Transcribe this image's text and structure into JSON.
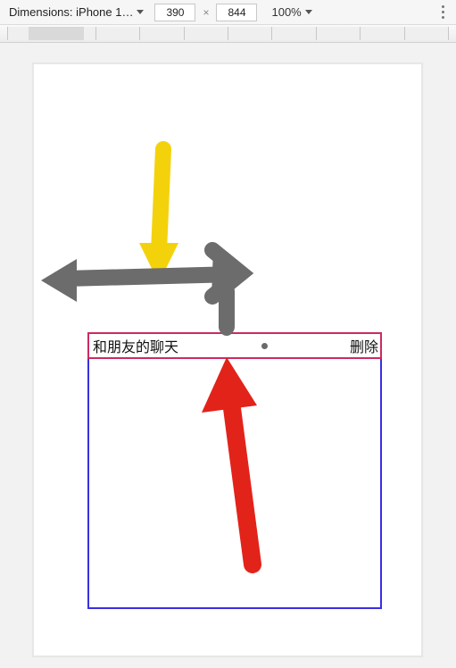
{
  "toolbar": {
    "device_label": "Dimensions: iPhone 1…",
    "width_value": "390",
    "height_value": "844",
    "dim_separator": "×",
    "zoom_label": "100%"
  },
  "card": {
    "title": "和朋友的聊天",
    "delete_label": "删除"
  },
  "icons": {
    "dropdown": "dropdown-triangle",
    "kebab": "more-vert-icon",
    "dot": "drag-dot-icon"
  },
  "annotations": {
    "yellow_arrow": "points-down-to-drag-handle",
    "gray_arrow": "horizontal-double-arrow-drag-width",
    "red_arrow": "points-up-to-header-dot"
  }
}
